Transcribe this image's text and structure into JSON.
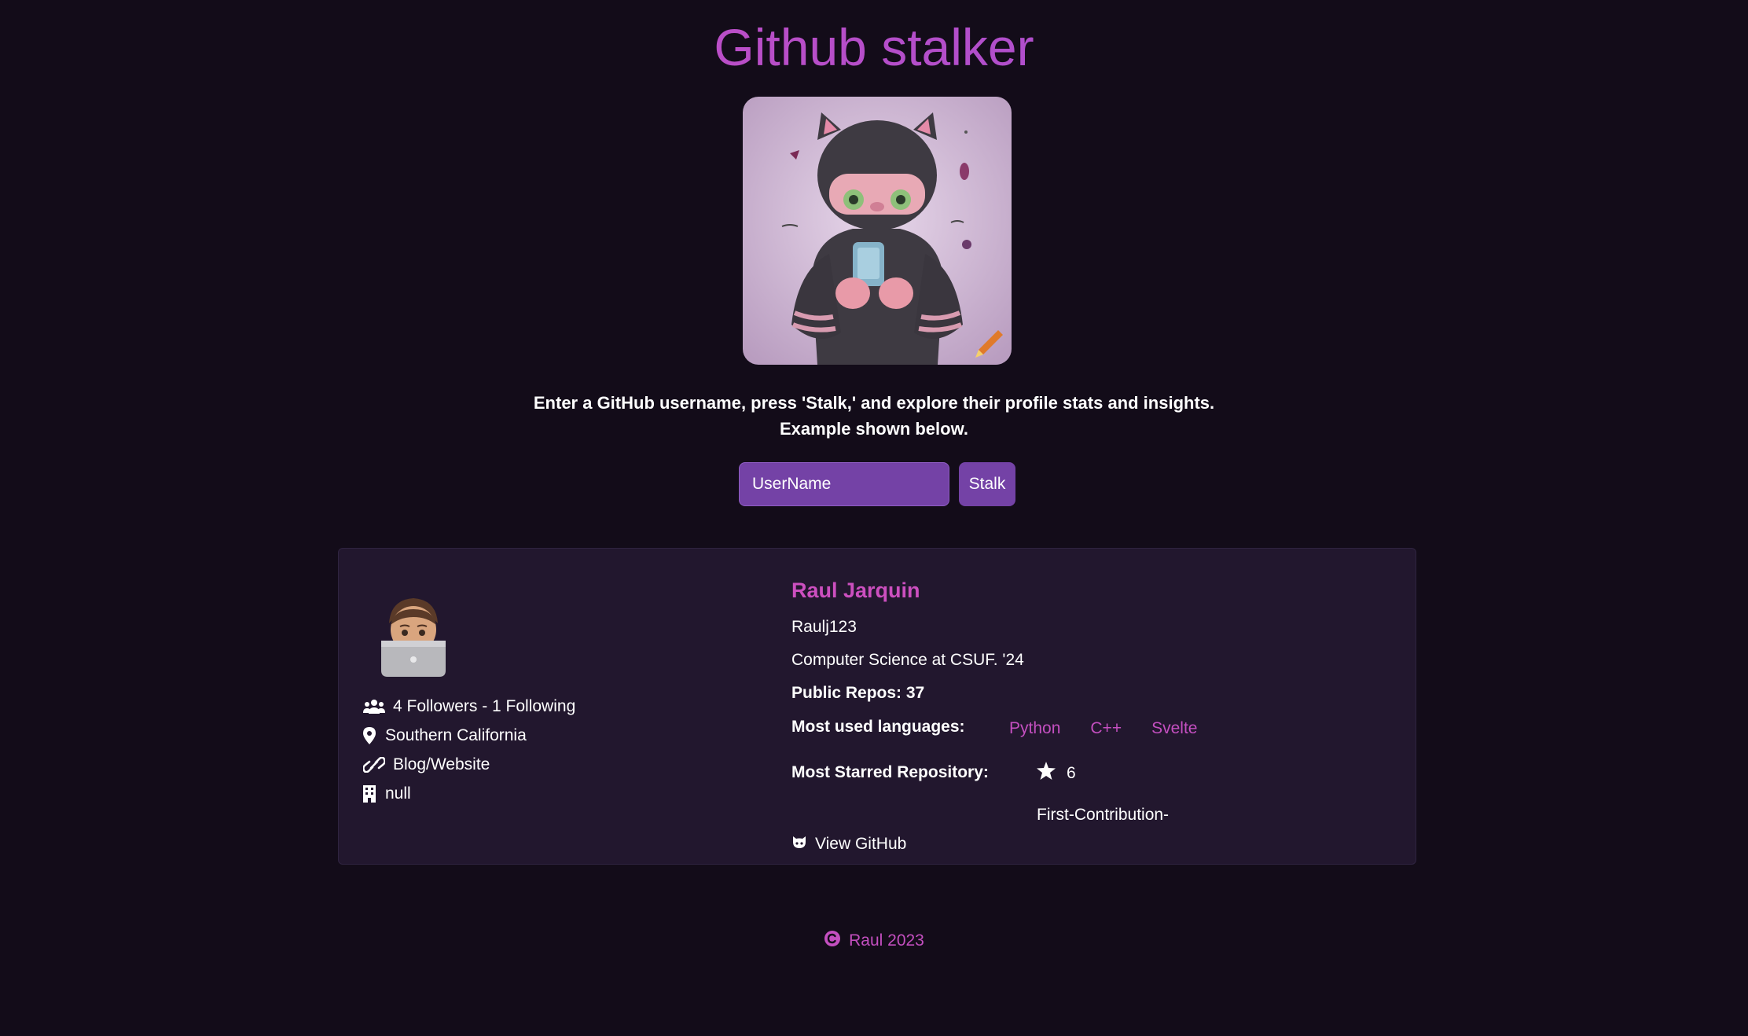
{
  "app": {
    "title": "Github stalker",
    "intro_line1": "Enter a GitHub username, press 'Stalk,' and explore their profile stats and insights.",
    "intro_line2": "Example shown below."
  },
  "search": {
    "placeholder": "UserName",
    "value": "",
    "button_label": "Stalk"
  },
  "profile": {
    "name": "Raul Jarquin",
    "username": "Raulj123",
    "bio": "Computer Science at CSUF. '24",
    "followers_text": "4 Followers - 1 Following",
    "location": "Southern California",
    "blog_label": "Blog/Website",
    "company": "null",
    "public_repos_text": "Public Repos: 37",
    "languages_label": "Most used languages:",
    "languages": [
      "Python",
      "C++",
      "Svelte"
    ],
    "starred_label": "Most Starred Repository:",
    "starred_count": "6",
    "starred_repo": "First-Contribution-",
    "view_github_label": "View GitHub"
  },
  "footer": {
    "text": "Raul 2023"
  },
  "icons": {
    "followers": "users-icon",
    "location": "map-pin-icon",
    "blog": "link-icon",
    "company": "building-icon",
    "star": "star-icon",
    "github": "github-icon",
    "copyright": "copyright-icon"
  },
  "colors": {
    "background": "#130c19",
    "card": "#22172e",
    "accent": "#c44fc0",
    "button": "#7442a6"
  }
}
